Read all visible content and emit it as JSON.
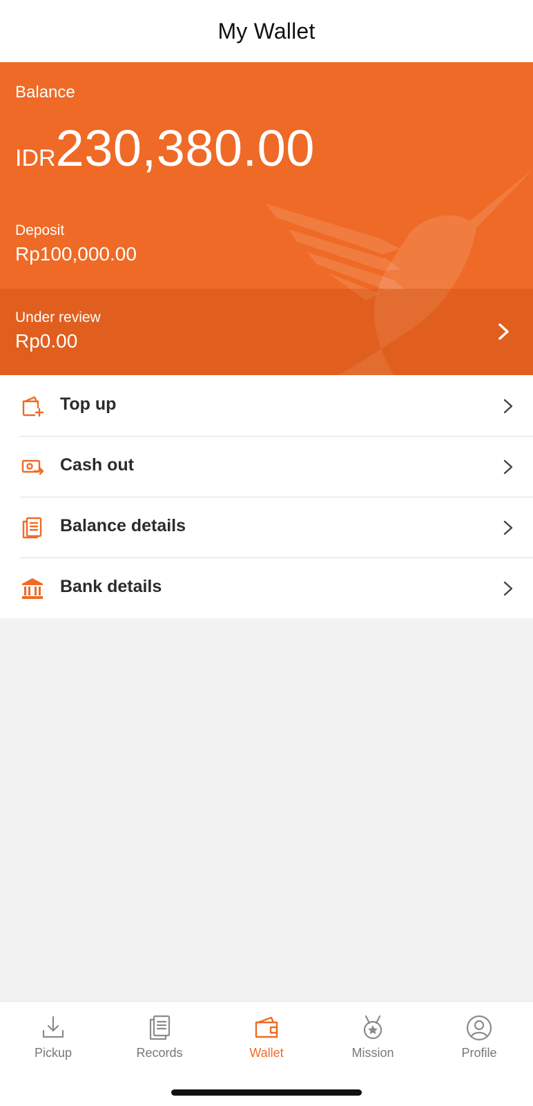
{
  "header": {
    "title": "My Wallet"
  },
  "balance_card": {
    "balance_label": "Balance",
    "currency": "IDR",
    "amount": "230,380.00",
    "deposit_label": "Deposit",
    "deposit_value": "Rp100,000.00",
    "review_label": "Under review",
    "review_value": "Rp0.00"
  },
  "menu": {
    "items": [
      {
        "label": "Top up",
        "icon": "wallet-add-icon"
      },
      {
        "label": "Cash out",
        "icon": "cash-out-icon"
      },
      {
        "label": "Balance details",
        "icon": "document-list-icon"
      },
      {
        "label": "Bank details",
        "icon": "bank-icon"
      }
    ]
  },
  "tabbar": {
    "tabs": [
      {
        "label": "Pickup",
        "icon": "download-tray-icon",
        "active": false
      },
      {
        "label": "Records",
        "icon": "records-icon",
        "active": false
      },
      {
        "label": "Wallet",
        "icon": "wallet-icon",
        "active": true
      },
      {
        "label": "Mission",
        "icon": "medal-icon",
        "active": false
      },
      {
        "label": "Profile",
        "icon": "user-icon",
        "active": false
      }
    ]
  },
  "colors": {
    "accent": "#ef6a26",
    "tab_inactive": "#777777",
    "background": "#f2f2f2"
  }
}
